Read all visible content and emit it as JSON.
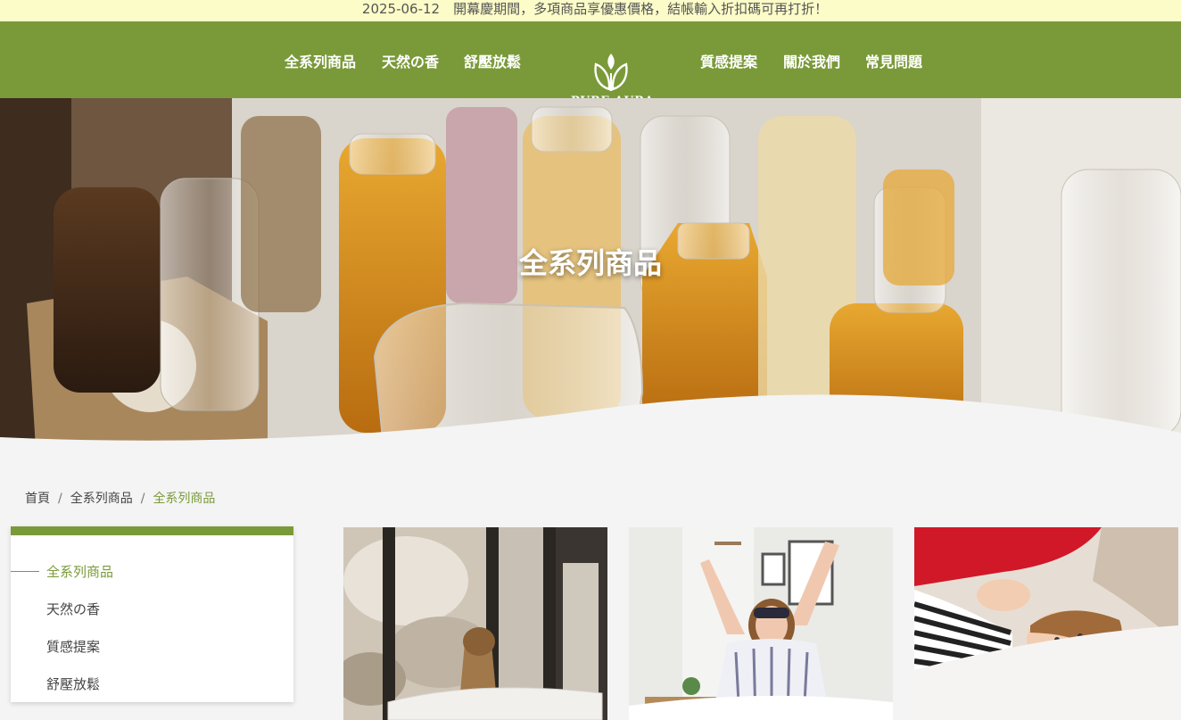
{
  "announcement": "2025-06-12　開幕慶期間，多項商品享優惠價格，結帳輸入折扣碼可再打折！",
  "nav": {
    "left": [
      "全系列商品",
      "天然の香",
      "舒壓放鬆"
    ],
    "right": [
      "質感提案",
      "關於我們",
      "常見問題"
    ],
    "logo_text": "PURE AURA"
  },
  "hero": {
    "title": "全系列商品"
  },
  "breadcrumb": {
    "items": [
      "首頁",
      "全系列商品",
      "全系列商品"
    ]
  },
  "sidebar": {
    "items": [
      "全系列商品",
      "天然の香",
      "質感提案",
      "舒壓放鬆"
    ],
    "active_index": 0
  },
  "colors": {
    "brand": "#7a9a3a",
    "announce_bg": "#fcfcc8",
    "page_bg": "#f4f4f4"
  },
  "products": [
    {
      "image": "woman-in-bathtub-photo"
    },
    {
      "image": "woman-stretching-in-bed-photo"
    },
    {
      "image": "child-under-blanket-photo"
    }
  ]
}
